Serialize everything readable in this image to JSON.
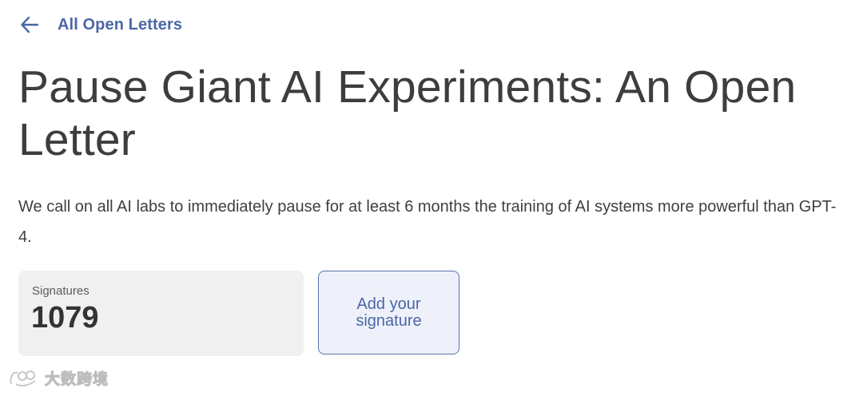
{
  "nav": {
    "back_label": "All Open Letters",
    "back_icon": "arrow-left-icon"
  },
  "letter": {
    "title": "Pause Giant AI Experiments: An Open Letter",
    "intro": "We call on all AI labs to immediately pause for at least 6 months the training of AI systems more powerful than GPT-4."
  },
  "signatures": {
    "label": "Signatures",
    "count": "1079"
  },
  "actions": {
    "add_signature_label": "Add your signature"
  },
  "watermark": {
    "text": "大数跨境"
  },
  "colors": {
    "accent": "#4a67a9",
    "button_bg": "#eef1f9",
    "card_bg": "#f0f0f0",
    "text": "#3d3d3d"
  }
}
